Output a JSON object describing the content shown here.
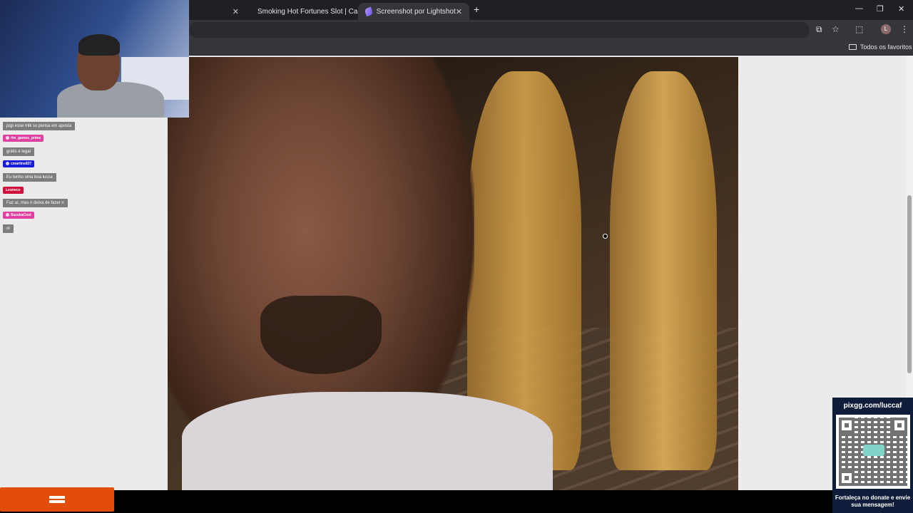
{
  "browser": {
    "tabs": [
      {
        "title": "",
        "active": false
      },
      {
        "title": "Smoking Hot Fortunes Slot | Ca",
        "active": false
      },
      {
        "title": "Screenshot por Lightshot",
        "active": true
      }
    ],
    "new_tab_label": "+",
    "bookmarks_all_label": "Todos os favoritos",
    "profile_initial": "L"
  },
  "chat": {
    "messages": [
      {
        "user": "",
        "text": "pqp esse mlk so pensa em aposta",
        "user_color": "#7d7d7d"
      },
      {
        "user": "rlw_games_prime",
        "text": "grátis é legal",
        "user_color": "#e040a0"
      },
      {
        "user": "cmartins837",
        "text": "Eu tenho uma boa lucca",
        "user_color": "#1a1adb"
      },
      {
        "user": "Leoneco",
        "text": "Faz aí, mas n deixa de fazer n",
        "user_color": "#d0103a"
      },
      {
        "user": "SuzukaCost",
        "text": "oi",
        "user_color": "#e040a0"
      }
    ]
  },
  "donate": {
    "url": "pixgg.com/luccaf",
    "note": "Fortaleça no donate e envie sua mensagem!"
  },
  "colors": {
    "brand_orange": "#e34d0c",
    "donate_bg": "#0f1d3a"
  }
}
